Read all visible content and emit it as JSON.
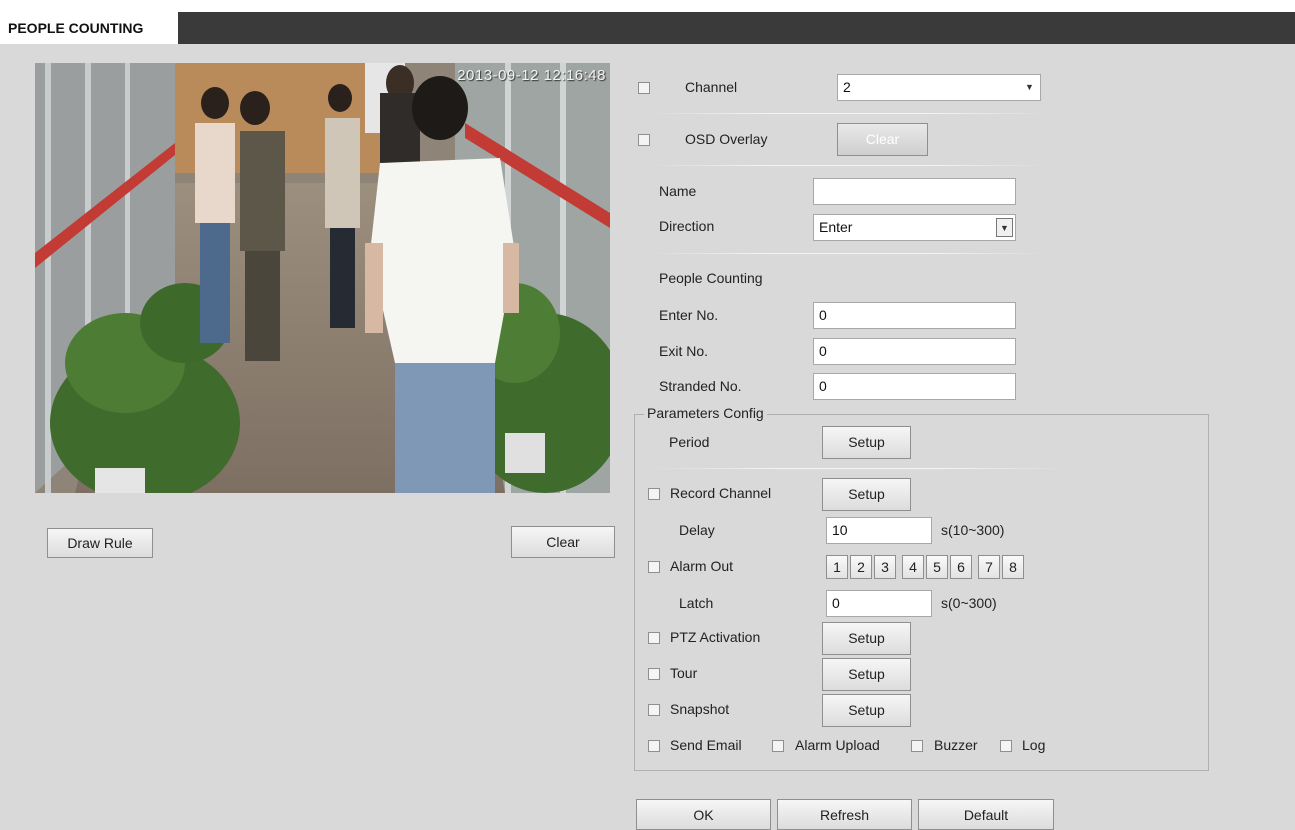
{
  "page": {
    "title": "PEOPLE COUNTING"
  },
  "video": {
    "timestamp": "2013-09-12 12:16:48"
  },
  "left_buttons": {
    "draw_rule": "Draw Rule",
    "clear": "Clear"
  },
  "form": {
    "channel_label": "Channel",
    "channel_value": "2",
    "osd_label": "OSD Overlay",
    "osd_clear": "Clear",
    "name_label": "Name",
    "name_value": "",
    "direction_label": "Direction",
    "direction_value": "Enter",
    "people_counting_label": "People Counting",
    "enter_label": "Enter No.",
    "enter_value": "0",
    "exit_label": "Exit No.",
    "exit_value": "0",
    "stranded_label": "Stranded No.",
    "stranded_value": "0"
  },
  "params": {
    "legend": "Parameters Config",
    "period_label": "Period",
    "setup": "Setup",
    "record_label": "Record Channel",
    "delay_label": "Delay",
    "delay_value": "10",
    "delay_range": "s(10~300)",
    "alarm_out_label": "Alarm Out",
    "alarm_out_numbers": [
      "1",
      "2",
      "3",
      "4",
      "5",
      "6",
      "7",
      "8"
    ],
    "latch_label": "Latch",
    "latch_value": "0",
    "latch_range": "s(0~300)",
    "ptz_label": "PTZ Activation",
    "tour_label": "Tour",
    "snapshot_label": "Snapshot",
    "send_email_label": "Send Email",
    "alarm_upload_label": "Alarm Upload",
    "buzzer_label": "Buzzer",
    "log_label": "Log"
  },
  "footer": {
    "ok": "OK",
    "refresh": "Refresh",
    "default": "Default"
  }
}
